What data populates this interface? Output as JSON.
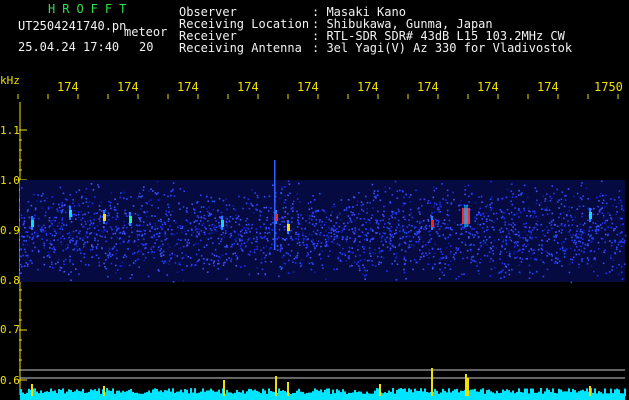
{
  "header": {
    "brand": "HROFFT",
    "filename": "UT2504241740.pn",
    "tag": "meteor",
    "datetime": "25.04.24 17:40",
    "minute_tag": "20",
    "fields": [
      {
        "label": "Observer",
        "value": ": Masaki Kano"
      },
      {
        "label": "Receiving Location",
        "value": ": Shibukawa, Gunma, Japan"
      },
      {
        "label": "Receiver",
        "value": ": RTL-SDR SDR# 43dB L15 103.2MHz CW"
      },
      {
        "label": "Receiving Antenna",
        "value": ": 3el Yagi(V) Az 330 for Vladivostok"
      }
    ]
  },
  "time_axis": {
    "ticks": [
      "174",
      "174",
      "174",
      "174",
      "174",
      "174",
      "174",
      "174",
      "174",
      "1750"
    ]
  },
  "freq_axis": {
    "unit": "kHz",
    "ticks": [
      "1.1",
      "1.0",
      "0.9",
      "0.8",
      "0.7",
      "0.6"
    ]
  },
  "colors": {
    "background": "#000000",
    "noise_band": "#1a2cff",
    "strip": "#00e5ff",
    "echo_peak": "#ff2020",
    "text_header": "#f2f2f2",
    "brand": "#2fe04a",
    "labels": "#f0e000"
  }
}
